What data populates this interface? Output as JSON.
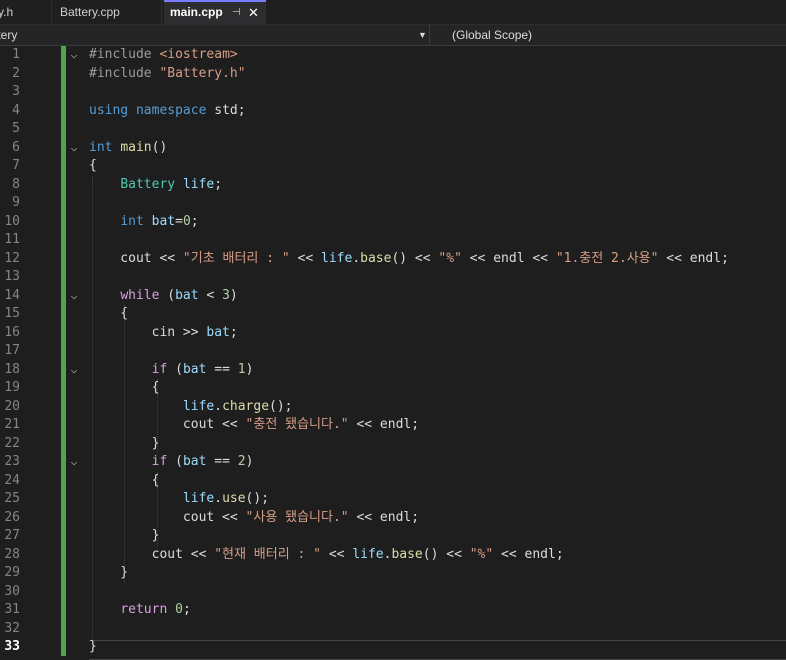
{
  "tabs": [
    {
      "label": "y.h",
      "active": false
    },
    {
      "label": "Battery.cpp",
      "active": false
    },
    {
      "label": "main.cpp",
      "active": true
    }
  ],
  "tab_pin_glyph": "⊣",
  "tab_close_glyph": "✕",
  "nav": {
    "left": "ttery",
    "right": "(Global Scope)"
  },
  "current_line": 33,
  "code_lines": [
    [
      {
        "t": "#include ",
        "c": "pp"
      },
      {
        "t": "<iostream>",
        "c": "str"
      }
    ],
    [
      {
        "t": "#include ",
        "c": "pp"
      },
      {
        "t": "\"Battery.h\"",
        "c": "str"
      }
    ],
    [],
    [
      {
        "t": "using ",
        "c": "kw"
      },
      {
        "t": "namespace ",
        "c": "kw"
      },
      {
        "t": "std;",
        "c": "op"
      }
    ],
    [],
    [
      {
        "t": "int ",
        "c": "kw"
      },
      {
        "t": "main",
        "c": "fn"
      },
      {
        "t": "()",
        "c": "op"
      }
    ],
    [
      {
        "t": "{",
        "c": "op"
      }
    ],
    [
      {
        "t": "    ",
        "c": "op"
      },
      {
        "t": "Battery ",
        "c": "type"
      },
      {
        "t": "life",
        "c": "var"
      },
      {
        "t": ";",
        "c": "op"
      }
    ],
    [],
    [
      {
        "t": "    ",
        "c": "op"
      },
      {
        "t": "int ",
        "c": "kw"
      },
      {
        "t": "bat",
        "c": "var"
      },
      {
        "t": "=",
        "c": "op"
      },
      {
        "t": "0",
        "c": "num"
      },
      {
        "t": ";",
        "c": "op"
      }
    ],
    [],
    [
      {
        "t": "    cout << ",
        "c": "op"
      },
      {
        "t": "\"기초 배터리 : \"",
        "c": "str"
      },
      {
        "t": " << ",
        "c": "op"
      },
      {
        "t": "life",
        "c": "var"
      },
      {
        "t": ".",
        "c": "op"
      },
      {
        "t": "base",
        "c": "fn"
      },
      {
        "t": "() << ",
        "c": "op"
      },
      {
        "t": "\"%\"",
        "c": "str"
      },
      {
        "t": " << endl << ",
        "c": "op"
      },
      {
        "t": "\"1.충전 2.사용\"",
        "c": "str"
      },
      {
        "t": " << endl;",
        "c": "op"
      }
    ],
    [],
    [
      {
        "t": "    ",
        "c": "op"
      },
      {
        "t": "while ",
        "c": "ctl"
      },
      {
        "t": "(",
        "c": "op"
      },
      {
        "t": "bat",
        "c": "var"
      },
      {
        "t": " < ",
        "c": "op"
      },
      {
        "t": "3",
        "c": "num"
      },
      {
        "t": ")",
        "c": "op"
      }
    ],
    [
      {
        "t": "    {",
        "c": "op"
      }
    ],
    [
      {
        "t": "        cin >> ",
        "c": "op"
      },
      {
        "t": "bat",
        "c": "var"
      },
      {
        "t": ";",
        "c": "op"
      }
    ],
    [],
    [
      {
        "t": "        ",
        "c": "op"
      },
      {
        "t": "if ",
        "c": "ctl"
      },
      {
        "t": "(",
        "c": "op"
      },
      {
        "t": "bat",
        "c": "var"
      },
      {
        "t": " == ",
        "c": "op"
      },
      {
        "t": "1",
        "c": "num"
      },
      {
        "t": ")",
        "c": "op"
      }
    ],
    [
      {
        "t": "        {",
        "c": "op"
      }
    ],
    [
      {
        "t": "            ",
        "c": "op"
      },
      {
        "t": "life",
        "c": "var"
      },
      {
        "t": ".",
        "c": "op"
      },
      {
        "t": "charge",
        "c": "fn"
      },
      {
        "t": "();",
        "c": "op"
      }
    ],
    [
      {
        "t": "            cout << ",
        "c": "op"
      },
      {
        "t": "\"충전 됐습니다.\"",
        "c": "str"
      },
      {
        "t": " << endl;",
        "c": "op"
      }
    ],
    [
      {
        "t": "        }",
        "c": "op"
      }
    ],
    [
      {
        "t": "        ",
        "c": "op"
      },
      {
        "t": "if ",
        "c": "ctl"
      },
      {
        "t": "(",
        "c": "op"
      },
      {
        "t": "bat",
        "c": "var"
      },
      {
        "t": " == ",
        "c": "op"
      },
      {
        "t": "2",
        "c": "num"
      },
      {
        "t": ")",
        "c": "op"
      }
    ],
    [
      {
        "t": "        {",
        "c": "op"
      }
    ],
    [
      {
        "t": "            ",
        "c": "op"
      },
      {
        "t": "life",
        "c": "var"
      },
      {
        "t": ".",
        "c": "op"
      },
      {
        "t": "use",
        "c": "fn"
      },
      {
        "t": "();",
        "c": "op"
      }
    ],
    [
      {
        "t": "            cout << ",
        "c": "op"
      },
      {
        "t": "\"사용 됐습니다.\"",
        "c": "str"
      },
      {
        "t": " << endl;",
        "c": "op"
      }
    ],
    [
      {
        "t": "        }",
        "c": "op"
      }
    ],
    [
      {
        "t": "        cout << ",
        "c": "op"
      },
      {
        "t": "\"현재 배터리 : \"",
        "c": "str"
      },
      {
        "t": " << ",
        "c": "op"
      },
      {
        "t": "life",
        "c": "var"
      },
      {
        "t": ".",
        "c": "op"
      },
      {
        "t": "base",
        "c": "fn"
      },
      {
        "t": "() << ",
        "c": "op"
      },
      {
        "t": "\"%\"",
        "c": "str"
      },
      {
        "t": " << endl;",
        "c": "op"
      }
    ],
    [
      {
        "t": "    }",
        "c": "op"
      }
    ],
    [],
    [
      {
        "t": "    ",
        "c": "op"
      },
      {
        "t": "return ",
        "c": "ctl"
      },
      {
        "t": "0",
        "c": "num"
      },
      {
        "t": ";",
        "c": "op"
      }
    ],
    [],
    [
      {
        "t": "}",
        "c": "op"
      }
    ]
  ],
  "fold_lines": [
    1,
    6,
    14,
    18,
    23
  ]
}
